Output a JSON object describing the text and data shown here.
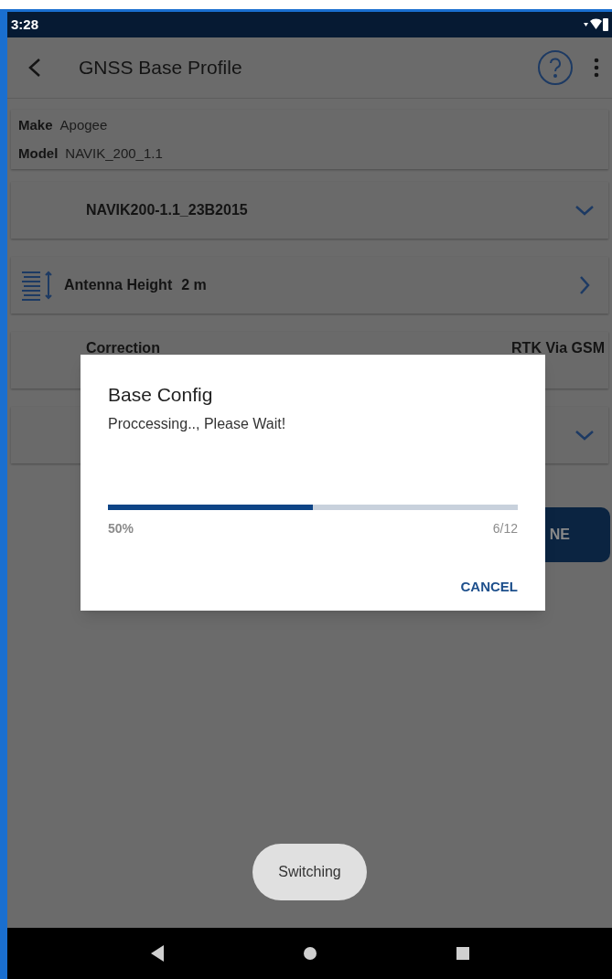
{
  "status_bar": {
    "time": "3:28"
  },
  "app_bar": {
    "title": "GNSS Base Profile"
  },
  "info_card": {
    "rows": [
      {
        "label": "Make",
        "value": "Apogee"
      },
      {
        "label": "Model",
        "value": "NAVIK_200_1.1"
      }
    ]
  },
  "rows": [
    {
      "kind": "dropdown",
      "text": "NAVIK200-1.1_23B2015"
    },
    {
      "kind": "link",
      "label": "Antenna Height",
      "value": "2 m"
    },
    {
      "kind": "pair",
      "label": "Correction",
      "value": "RTK Via GSM"
    },
    {
      "kind": "dropdown",
      "text": ""
    }
  ],
  "done_button": {
    "label": "NE"
  },
  "dialog": {
    "title": "Base Config",
    "message": "Proccessing.., Please Wait!",
    "progress": {
      "level": 0.5,
      "percent": "50%",
      "count": "6/12"
    },
    "button": "CANCEL"
  },
  "toast": "Switching"
}
